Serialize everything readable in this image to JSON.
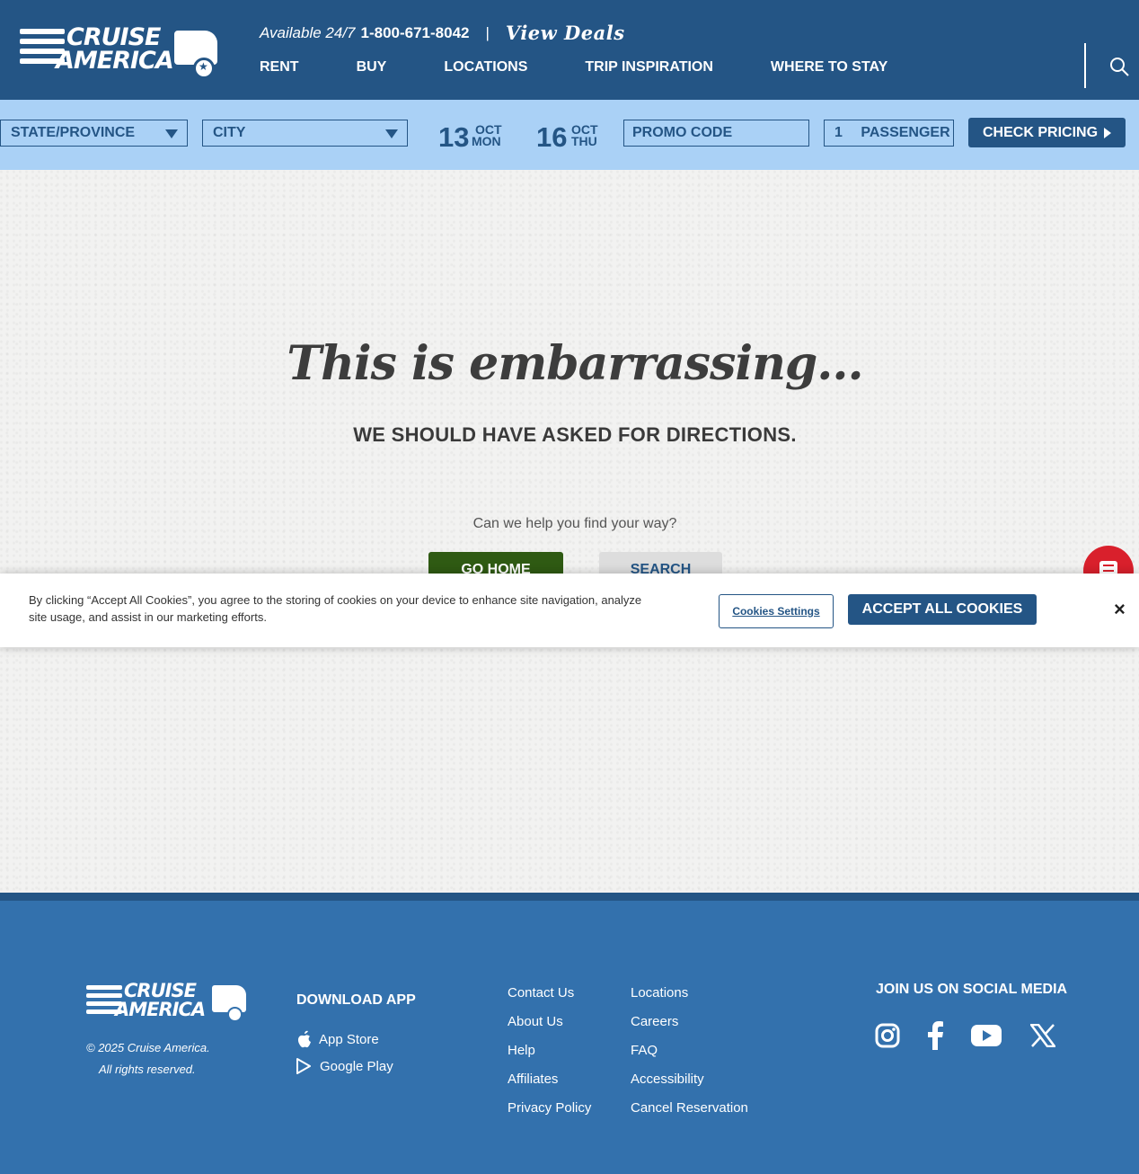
{
  "brand": {
    "line1": "CRUISE",
    "line2": "AMERICA"
  },
  "header": {
    "available": "Available 24/7",
    "phone": "1-800-671-8042",
    "separator": "|",
    "view_deals": "View Deals",
    "nav": [
      "RENT",
      "BUY",
      "LOCATIONS",
      "TRIP INSPIRATION",
      "WHERE TO STAY"
    ]
  },
  "booking": {
    "state": "STATE/PROVINCE",
    "city": "CITY",
    "pickup": {
      "day": "13",
      "month": "OCT",
      "weekday": "MON"
    },
    "dropoff": {
      "day": "16",
      "month": "OCT",
      "weekday": "THU"
    },
    "promo": "PROMO CODE",
    "passengers_count": "1",
    "passengers_label": "PASSENGER",
    "check_pricing": "CHECK PRICING"
  },
  "error": {
    "headline": "This is embarrassing...",
    "subhead": "WE SHOULD HAVE ASKED FOR DIRECTIONS.",
    "help": "Can we help you find your way?",
    "go_home": "GO HOME",
    "search": "SEARCH"
  },
  "cookie": {
    "text": "By clicking “Accept All Cookies”, you agree to the storing of cookies on your device to enhance site navigation, analyze site usage, and assist in our marketing efforts.",
    "settings": "Cookies Settings",
    "accept": "ACCEPT ALL COOKIES",
    "close": "×"
  },
  "footer": {
    "copyright": "© 2025 Cruise America.",
    "rights": "All rights reserved.",
    "download_title": "DOWNLOAD APP",
    "app_store": "App Store",
    "google_play": "Google Play",
    "links_col1": [
      "Contact Us",
      "About Us",
      "Help",
      "Affiliates",
      "Privacy Policy"
    ],
    "links_col2": [
      "Locations",
      "Careers",
      "FAQ",
      "Accessibility",
      "Cancel Reservation"
    ],
    "social_title": "JOIN US ON SOCIAL MEDIA",
    "social_icons": [
      "instagram-icon",
      "facebook-icon",
      "youtube-icon",
      "x-icon"
    ]
  },
  "colors": {
    "header": "#245585",
    "booking_bar": "#aad1f6",
    "footer": "#3371ad",
    "go_home": "#2f5a13",
    "chat": "#d9202c"
  }
}
